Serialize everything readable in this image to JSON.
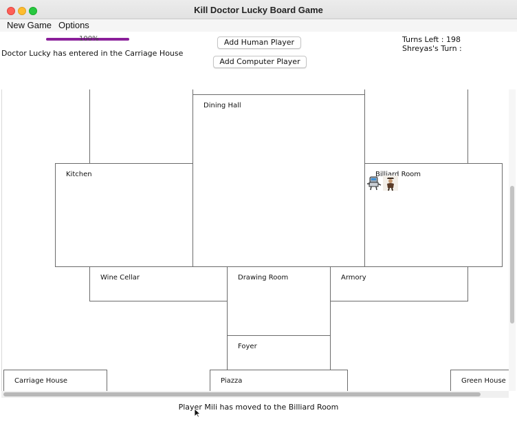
{
  "window": {
    "title": "Kill Doctor Lucky Board Game"
  },
  "menu": {
    "new_game": "New Game",
    "options": "Options"
  },
  "top": {
    "health_label": "100%",
    "health_fraction": 1.0,
    "lucky_message": "Doctor Lucky has entered in the Carriage House",
    "add_human": "Add Human Player",
    "add_computer": "Add Computer Player",
    "turns_left": "Turns Left : 198",
    "current_turn": "Shreyas's Turn :"
  },
  "rooms": {
    "dining_hall": "Dining Hall",
    "kitchen": "Kitchen",
    "billiard_room": "Billiard Room",
    "wine_cellar": "Wine Cellar",
    "drawing_room": "Drawing Room",
    "armory": "Armory",
    "foyer": "Foyer",
    "carriage_house": "Carriage House",
    "piazza": "Piazza",
    "green_house": "Green House"
  },
  "players_in_billiard_room": [
    "robot-player-icon",
    "human-player-icon"
  ],
  "status": {
    "message": "Player Mili has moved to the Billiard Room"
  },
  "colors": {
    "health_bar": "#8a1f9a",
    "room_border": "#6a6a6a"
  }
}
